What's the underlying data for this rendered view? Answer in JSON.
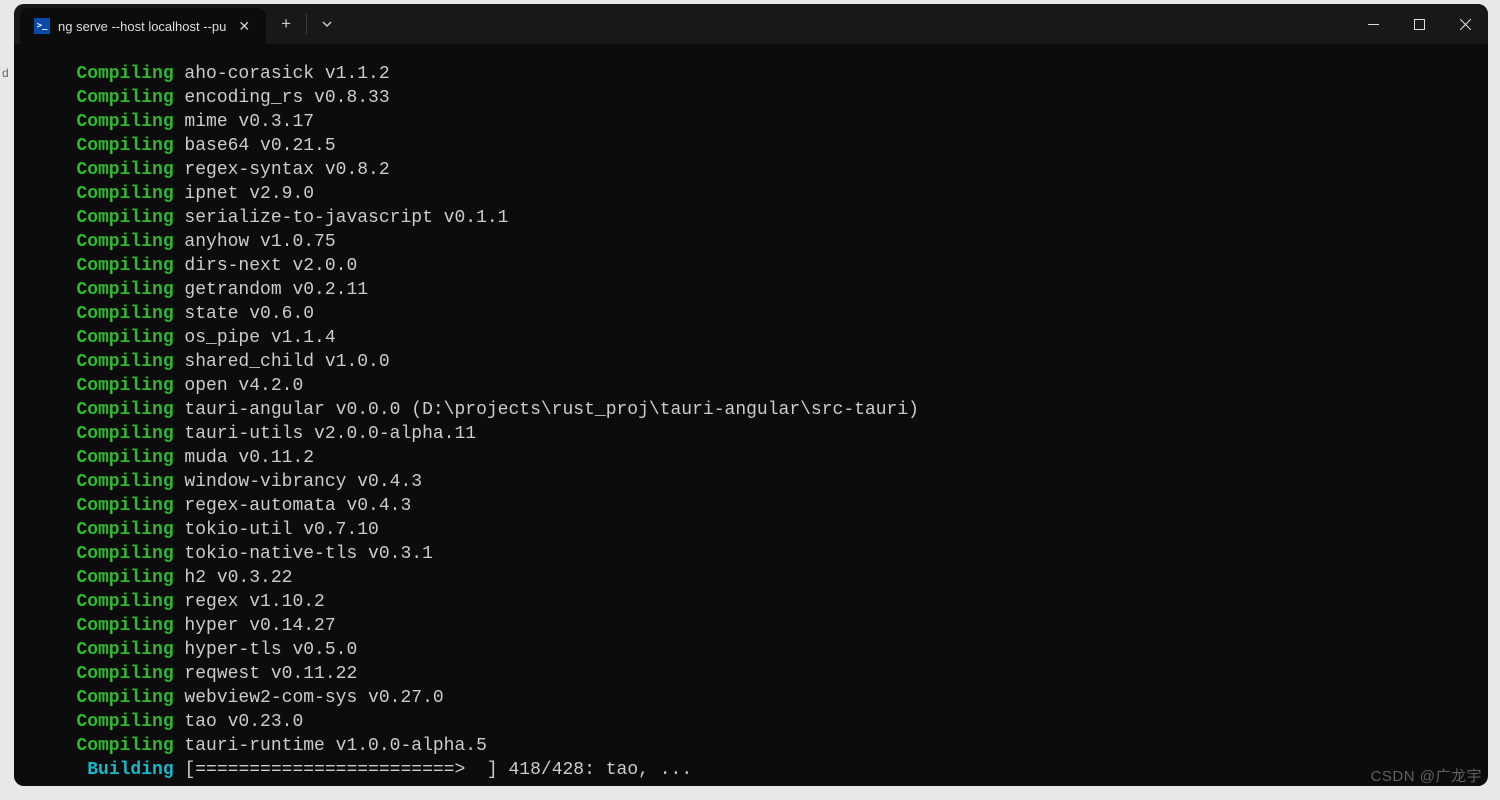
{
  "window": {
    "tab_title": "ng serve --host localhost --pu",
    "ps_icon_glyph": ">_"
  },
  "terminal": {
    "indent_compile": "   ",
    "indent_build": "    ",
    "compile_lines": [
      "aho-corasick v1.1.2",
      "encoding_rs v0.8.33",
      "mime v0.3.17",
      "base64 v0.21.5",
      "regex-syntax v0.8.2",
      "ipnet v2.9.0",
      "serialize-to-javascript v0.1.1",
      "anyhow v1.0.75",
      "dirs-next v2.0.0",
      "getrandom v0.2.11",
      "state v0.6.0",
      "os_pipe v1.1.4",
      "shared_child v1.0.0",
      "open v4.2.0",
      "tauri-angular v0.0.0 (D:\\projects\\rust_proj\\tauri-angular\\src-tauri)",
      "tauri-utils v2.0.0-alpha.11",
      "muda v0.11.2",
      "window-vibrancy v0.4.3",
      "regex-automata v0.4.3",
      "tokio-util v0.7.10",
      "tokio-native-tls v0.3.1",
      "h2 v0.3.22",
      "regex v1.10.2",
      "hyper v0.14.27",
      "hyper-tls v0.5.0",
      "reqwest v0.11.22",
      "webview2-com-sys v0.27.0",
      "tao v0.23.0",
      "tauri-runtime v1.0.0-alpha.5"
    ],
    "building_line": "[========================>  ] 418/428: tao, ..."
  },
  "watermark": "CSDN @广龙宇"
}
